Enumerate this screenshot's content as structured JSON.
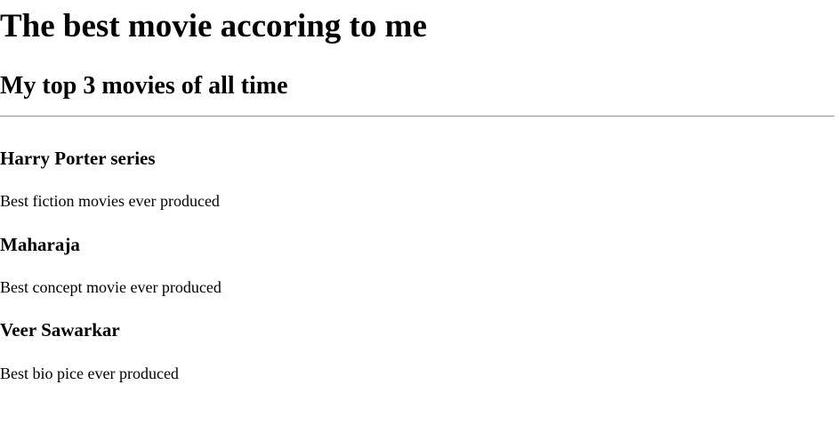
{
  "page": {
    "title": "The best movie accoring to me",
    "subtitle": "My top 3 movies of all time"
  },
  "movies": [
    {
      "title": "Harry Porter series",
      "description": "Best fiction movies ever produced"
    },
    {
      "title": "Maharaja",
      "description": "Best concept movie ever produced"
    },
    {
      "title": "Veer Sawarkar",
      "description": "Best bio pice ever produced"
    }
  ]
}
